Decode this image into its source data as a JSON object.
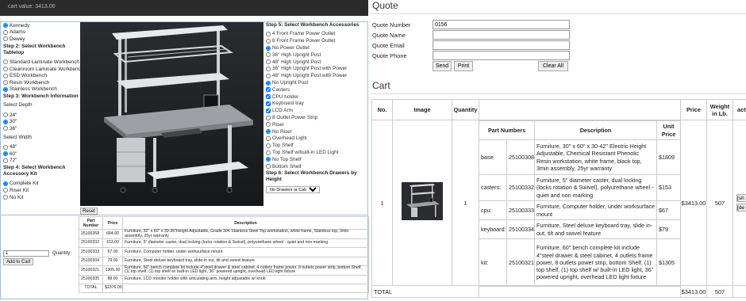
{
  "topbar": {
    "cart_value": "cart value: 3413.00"
  },
  "config": {
    "locations": [
      "Kennedy",
      "Adams",
      "Dewey"
    ],
    "step2": "Step 2: Select Workbench Tabletop",
    "tabletops": [
      "Standard Laminate Workbench",
      "Cleanroom Laminate Workbench",
      "ESD Workbench",
      "Resin Workbench",
      "Stainless Workbench"
    ],
    "step3": "Step 3: Workbench Information",
    "select_depth": "Select Depth",
    "depths": [
      "24\"",
      "30\"",
      "36\""
    ],
    "select_width": "Select Width",
    "widths": [
      "48\"",
      "60\"",
      "72\""
    ],
    "step4": "Step 4: Select Workbench Accessory Kit",
    "kits": [
      "Complete Kit",
      "Riser Kit",
      "No Kit"
    ],
    "reset_label": "Reset",
    "step5": "Step 5: Select Workbench Accessories",
    "outlets": [
      "4 Front Frame Power Outlet",
      "8 Front Frame Power Outlet",
      "No Power Outlet"
    ],
    "posts": [
      "36\" High Upright Post",
      "48\" High Upright Post",
      "36\" High Upright Post with Power",
      "48\" High Upright Post with Power",
      "No Upright Post"
    ],
    "misc": [
      "Casters",
      "CPU holder",
      "Keyboard tray",
      "LCD Arm",
      "8 Outlet Power Strip"
    ],
    "risers": [
      "Riser",
      "No Riser"
    ],
    "shelves": [
      "Overhead Light",
      "Top Shelf",
      "Top Shelf w/built-in LED Light",
      "No Top Shelf",
      "Bottom Shelf"
    ],
    "step6": "Step 6: Select Workbench Drawers by Height",
    "drawer_select": "No Drawers or Cabinet"
  },
  "order": {
    "qty_value": "1",
    "qty_label": "Quantity",
    "add_to_cart": "Add to Cart",
    "headers": [
      "Part Number",
      "Price",
      "Description"
    ],
    "rows": [
      [
        "25100268",
        "684.00",
        "Furniture, 30\" x 60\" x 30-36\"Height Adjustable, Grade 304 Stainless Steel Top workstation, white frame, Stainless top, 3min assembly, 25yr warranty"
      ],
      [
        "25100332",
        "153.00",
        "Furniture, 5\" diameter caster, dual locking (locks rotation & Swivel), polyurethane wheel - quiet and non marking"
      ],
      [
        "25100333",
        "67.00",
        "Furniture, Computer holder, under worksurface mount"
      ],
      [
        "25100334",
        "79.00",
        "Furniture, Steel deluxe keyboard tray, slide-in out, tilt and swivel feature"
      ],
      [
        "25100321",
        "1305.00",
        "Furniture, 60\" bench complete kit include 4\"steel drawer & steel cabinet, 4 outlets frame power, 8 outlets power strip, bottom Shelf, (1) top shelf, (1) top shelf w/ built-in LED light, 36\" powered upright, overhead LED light fixture"
      ],
      [
        "25100335",
        "88.00",
        "Furniture, LCD monitor holder with articulating arm, height adjustable w/ knob"
      ]
    ],
    "total_label": "TOTAL",
    "total_value": "$2376.00"
  },
  "quote": {
    "title": "Quote",
    "number_label": "Quote Number",
    "number_value": "0156",
    "name_label": "Quote Name",
    "email_label": "Quote Email",
    "phone_label": "Quote Phone",
    "send_label": "Send",
    "print_label": "Print",
    "clear_label": "Clear All"
  },
  "cart": {
    "title": "Cart",
    "headers": {
      "no": "No.",
      "image": "Image",
      "quantity": "Quantity",
      "price": "Price",
      "weight": "Weight in Lb.",
      "actions": "acti"
    },
    "inner_headers": [
      "Part Numbers",
      "Description",
      "Unit Price"
    ],
    "row": {
      "no": "1",
      "quantity": "1",
      "price": "$3413.00",
      "weight": "507",
      "parts": [
        {
          "slot": "base:",
          "part": "25100308",
          "desc": "Furniture, 30\" x 60\" x 30-42\" Electric Height Adjustable, Chemical Resistant Phenolic Resin workstation, white frame, black top, 3min assembly, 25yr warranty",
          "price": "$1809"
        },
        {
          "slot": "casters:",
          "part": "25100332",
          "desc": "Furniture, 5\" diameter caster, dual locking (locks rotation & Swivel), polyurethane wheel - quiet and non marking",
          "price": "$153"
        },
        {
          "slot": "cpu:",
          "part": "25100333",
          "desc": "Furniture, Computer holder, under worksurface mount",
          "price": "$67"
        },
        {
          "slot": "keyboard:",
          "part": "25100334",
          "desc": "Furniture, Steel deluxe keyboard tray, slide in-out, tilt and swivel feature",
          "price": "$79"
        },
        {
          "slot": "kit:",
          "part": "25100321",
          "desc": "Furniture, 60\" bench complete kit include 4\"steel drawer & steel cabinet, 4 outlets frame power, 8 outlets power strip, bottom Shelf, (1) top shelf, (1) top shelf w/ built-in LED light, 36\" powered upright, overhead LED light fixture",
          "price": "$1305"
        }
      ],
      "show_label": "[sh",
      "delete_label": "[de"
    },
    "total_label": "TOTAL",
    "total_price": "$3413.00",
    "total_weight": "507"
  },
  "icons": {
    "workbench": "workbench-render-image",
    "thumb": "workbench-thumbnail-image"
  },
  "colors": {
    "topbar": "#2b2b2b",
    "panel_border": "#9ec0e0",
    "viewer_bg": "#1f2124"
  }
}
